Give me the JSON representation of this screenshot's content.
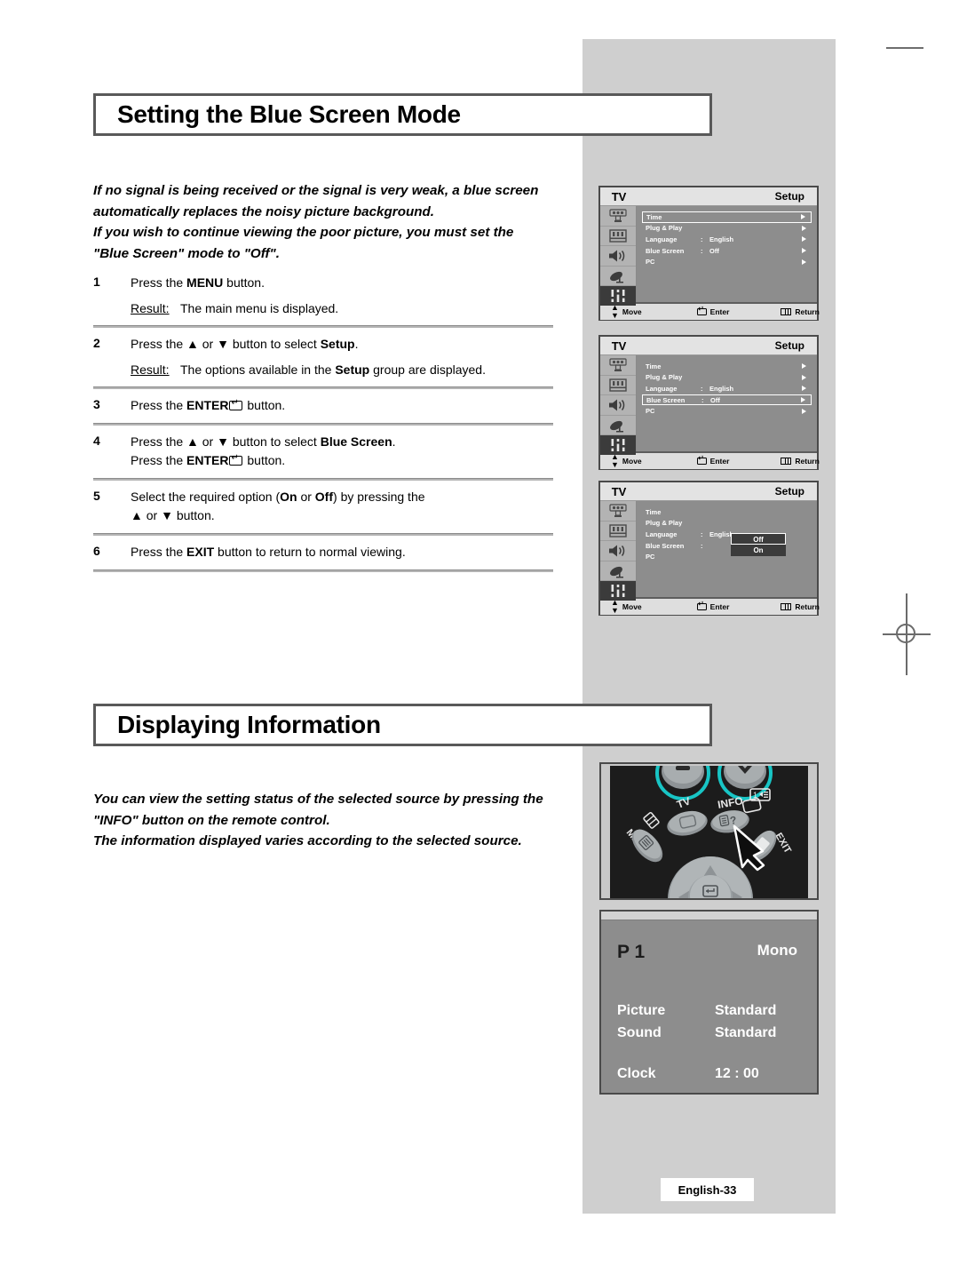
{
  "page": {
    "footer_label": "English-33"
  },
  "sections": [
    {
      "title": "Setting the Blue Screen Mode",
      "intro_lines": [
        "If no signal is being received or the signal is very weak, a blue screen",
        "automatically replaces the noisy picture background.",
        "If you wish to continue viewing the poor picture, you must set the",
        "\"Blue Screen\" mode to \"Off\"."
      ]
    },
    {
      "title": "Displaying Information",
      "intro_lines": [
        "You can view the setting status of the selected source by pressing the",
        "\"INFO\" button on the remote control.",
        "The information displayed varies according to the selected source."
      ]
    }
  ],
  "steps": [
    {
      "num": "1",
      "line1_pre": "Press the ",
      "line1_bold": "MENU",
      "line1_post": " button.",
      "result_label": "Result:",
      "result_text": "The main menu is displayed."
    },
    {
      "num": "2",
      "line1_pre": "Press the ▲ or ▼ button to select ",
      "line1_bold": "Setup",
      "line1_post": ".",
      "result_label": "Result:",
      "result_pre": "The options available in the ",
      "result_bold": "Setup",
      "result_post": " group are displayed."
    },
    {
      "num": "3",
      "line1_pre": "Press the ",
      "line1_bold": "ENTER",
      "line1_post": " button."
    },
    {
      "num": "4",
      "line1_pre": "Press the ▲ or ▼ button to select ",
      "line1_bold": "Blue Screen",
      "line1_post": ".",
      "line2_pre": "Press the ",
      "line2_bold": "ENTER",
      "line2_post": " button."
    },
    {
      "num": "5",
      "line1_pre": "Select the required option (",
      "line1_bold": "On",
      "line1_mid": " or ",
      "line1_bold2": "Off",
      "line1_post": ") by pressing the",
      "line2": "▲ or ▼ button."
    },
    {
      "num": "6",
      "line1_pre": "Press the ",
      "line1_bold": "EXIT",
      "line1_post": " button to return to normal viewing."
    }
  ],
  "osd": {
    "source_label": "TV",
    "group_label": "Setup",
    "side_icons": [
      "picture-icon",
      "channel-bars-icon",
      "speaker-icon",
      "satellite-dish-icon",
      "setup-sliders-icon"
    ],
    "bottom_bar": {
      "move": "Move",
      "enter": "Enter",
      "return": "Return"
    },
    "menus": [
      {
        "highlight": "Time",
        "rows": [
          {
            "label": "Time",
            "colon": "",
            "value": "",
            "arrow": true
          },
          {
            "label": "Plug & Play",
            "colon": "",
            "value": "",
            "arrow": true
          },
          {
            "label": "Language",
            "colon": ":",
            "value": "English",
            "arrow": true
          },
          {
            "label": "Blue Screen",
            "colon": ":",
            "value": "Off",
            "arrow": true
          },
          {
            "label": "PC",
            "colon": "",
            "value": "",
            "arrow": true
          }
        ]
      },
      {
        "highlight": "Blue Screen",
        "rows": [
          {
            "label": "Time",
            "colon": "",
            "value": "",
            "arrow": true
          },
          {
            "label": "Plug & Play",
            "colon": "",
            "value": "",
            "arrow": true
          },
          {
            "label": "Language",
            "colon": ":",
            "value": "English",
            "arrow": true
          },
          {
            "label": "Blue Screen",
            "colon": ":",
            "value": "Off",
            "arrow": true
          },
          {
            "label": "PC",
            "colon": "",
            "value": "",
            "arrow": true
          }
        ]
      },
      {
        "highlight": "",
        "rows": [
          {
            "label": "Time",
            "colon": "",
            "value": "",
            "arrow": false
          },
          {
            "label": "Plug & Play",
            "colon": "",
            "value": "",
            "arrow": false
          },
          {
            "label": "Language",
            "colon": ":",
            "value": "English",
            "arrow": false
          },
          {
            "label": "Blue Screen",
            "colon": ":",
            "value": "",
            "arrow": false
          },
          {
            "label": "PC",
            "colon": "",
            "value": "",
            "arrow": false
          }
        ],
        "dropdown": {
          "selected": "Off",
          "options": [
            "Off",
            "On"
          ]
        }
      }
    ]
  },
  "remote": {
    "buttons": [
      {
        "name": "volume-down-button",
        "label": "–"
      },
      {
        "name": "channel-down-button",
        "label": "⌄"
      },
      {
        "name": "prech-button",
        "label": "1◂≡"
      },
      {
        "name": "tv-button",
        "label": "TV"
      },
      {
        "name": "info-button",
        "label": "INFO"
      },
      {
        "name": "menu-button",
        "label": "MENU"
      },
      {
        "name": "exit-button",
        "label": "EXIT"
      },
      {
        "name": "enter-button",
        "label": "ENTER"
      }
    ]
  },
  "info_display": {
    "programme": "P 1",
    "sound_mode": "Mono",
    "rows": [
      {
        "label": "Picture",
        "value": "Standard"
      },
      {
        "label": "Sound",
        "value": "Standard"
      },
      {
        "label": "Clock",
        "value": "12 : 00"
      }
    ]
  }
}
